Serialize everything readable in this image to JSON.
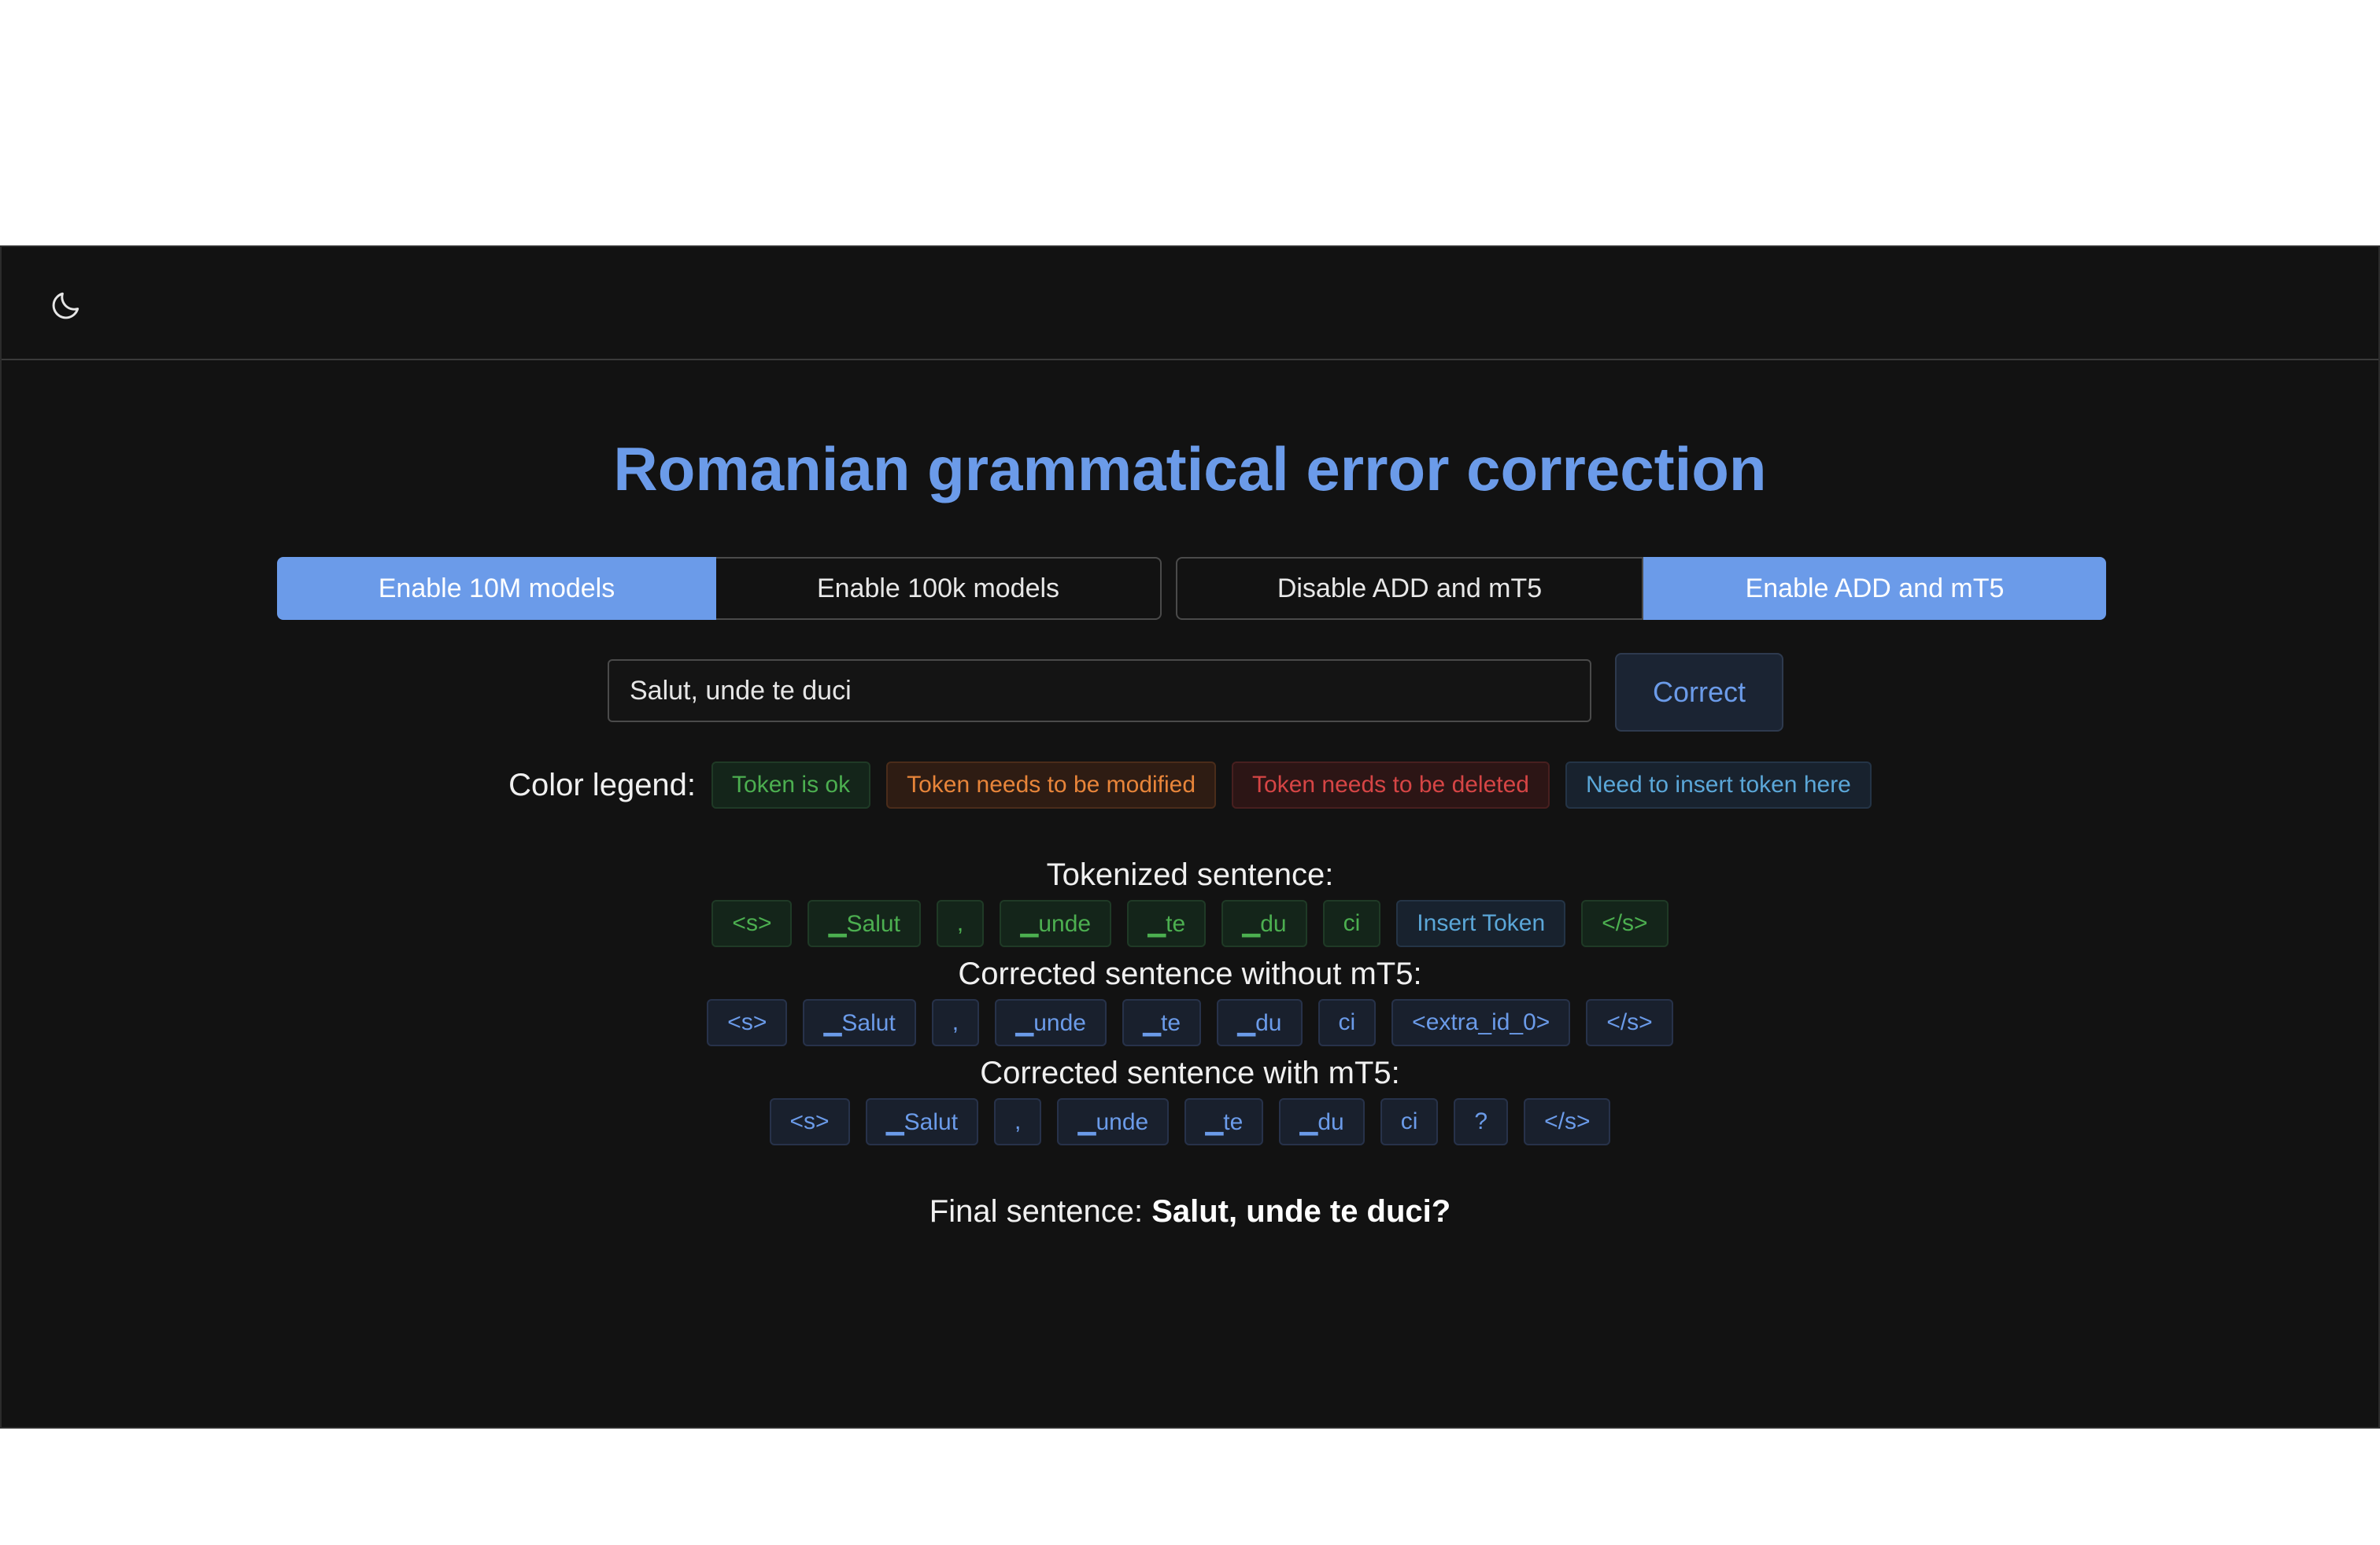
{
  "title": "Romanian grammatical error correction",
  "model_toggle": {
    "options": [
      "Enable 10M models",
      "Enable 100k models"
    ],
    "selected": "Enable 10M models"
  },
  "mt5_toggle": {
    "options": [
      "Disable ADD and mT5",
      "Enable ADD and mT5"
    ],
    "selected": "Enable ADD and mT5"
  },
  "input": {
    "value": "Salut, unde te duci"
  },
  "correct_button": "Correct",
  "legend": {
    "label": "Color legend:",
    "ok": "Token is ok",
    "modify": "Token needs to be modified",
    "delete": "Token needs to be deleted",
    "insert": "Need to insert token here"
  },
  "tokenized": {
    "title": "Tokenized sentence:",
    "tokens": [
      {
        "text": "<s>",
        "status": "ok"
      },
      {
        "text": "▁Salut",
        "status": "ok"
      },
      {
        "text": ",",
        "status": "ok"
      },
      {
        "text": "▁unde",
        "status": "ok"
      },
      {
        "text": "▁te",
        "status": "ok"
      },
      {
        "text": "▁du",
        "status": "ok"
      },
      {
        "text": "ci",
        "status": "ok"
      },
      {
        "text": "Insert Token",
        "status": "ins"
      },
      {
        "text": "</s>",
        "status": "ok"
      }
    ]
  },
  "corrected_without": {
    "title": "Corrected sentence without mT5:",
    "tokens": [
      "<s>",
      "▁Salut",
      ",",
      "▁unde",
      "▁te",
      "▁du",
      "ci",
      "<extra_id_0>",
      "</s>"
    ]
  },
  "corrected_with": {
    "title": "Corrected sentence with mT5:",
    "tokens": [
      "<s>",
      "▁Salut",
      ",",
      "▁unde",
      "▁te",
      "▁du",
      "ci",
      "?",
      "</s>"
    ]
  },
  "final": {
    "label": "Final sentence:",
    "value": "Salut, unde te duci?"
  },
  "icons": {
    "theme_toggle": "moon-icon"
  },
  "colors": {
    "accent": "#6b9be9",
    "background": "#121212",
    "ok": "#4caf50",
    "modify": "#e8853a",
    "delete": "#d64545",
    "insert": "#5ba7d8"
  }
}
